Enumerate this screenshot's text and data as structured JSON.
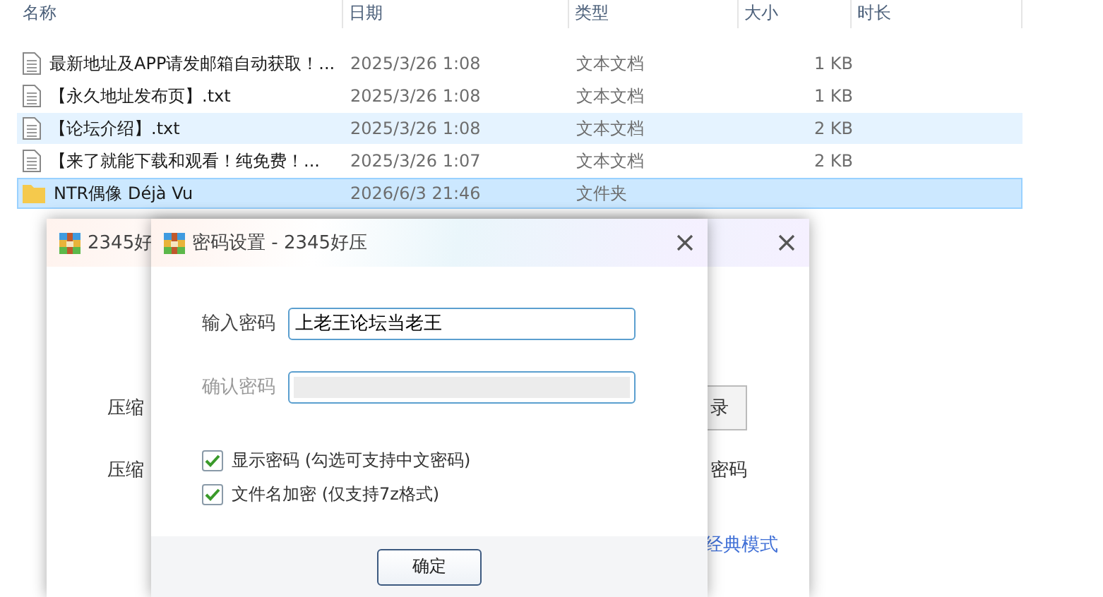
{
  "file_list": {
    "columns": [
      "名称",
      "日期",
      "类型",
      "大小",
      "时长"
    ],
    "rows": [
      {
        "kind": "file",
        "name": "最新地址及APP请发邮箱自动获取！...",
        "date": "2025/3/26 1:08",
        "type": "文本文档",
        "size": "1 KB",
        "hovered": false,
        "selected": false
      },
      {
        "kind": "file",
        "name": "【永久地址发布页】.txt",
        "date": "2025/3/26 1:08",
        "type": "文本文档",
        "size": "1 KB",
        "hovered": false,
        "selected": false
      },
      {
        "kind": "file",
        "name": "【论坛介绍】.txt",
        "date": "2025/3/26 1:08",
        "type": "文本文档",
        "size": "2 KB",
        "hovered": true,
        "selected": false
      },
      {
        "kind": "file",
        "name": "【来了就能下载和观看！纯免费！...",
        "date": "2025/3/26 1:07",
        "type": "文本文档",
        "size": "2 KB",
        "hovered": false,
        "selected": false
      },
      {
        "kind": "folder",
        "name": "NTR偶像 Déjà Vu",
        "date": "2026/6/3 21:46",
        "type": "文件夹",
        "hovered": false,
        "selected": true
      }
    ]
  },
  "back_window": {
    "title": "2345好",
    "row_1": {
      "label": "压缩",
      "button": "录"
    },
    "row_2": {
      "label": "压缩",
      "right_text": "密码"
    },
    "link": "经典模式"
  },
  "password_dialog": {
    "title": "密码设置 - 2345好压",
    "fields": [
      {
        "label": "输入密码",
        "value": "上老王论坛当老王",
        "disabled": false
      },
      {
        "label": "确认密码",
        "disabled": true
      }
    ],
    "checkboxes": [
      {
        "label": "显示密码 (勾选可支持中文密码)",
        "checked": true
      },
      {
        "label": "文件名加密  (仅支持7z格式)",
        "checked": true
      }
    ],
    "button": "确定"
  }
}
